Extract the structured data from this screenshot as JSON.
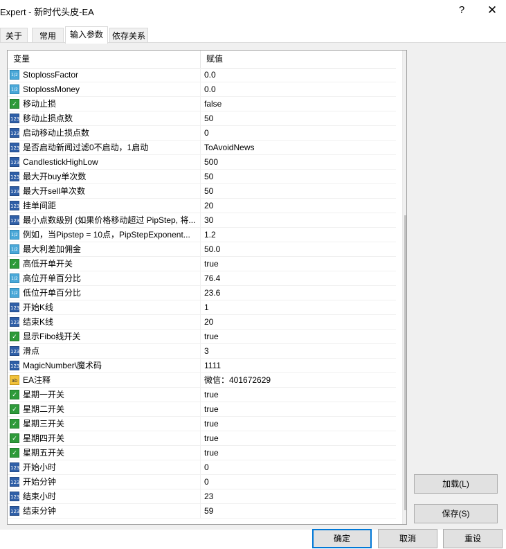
{
  "window": {
    "title": "Expert - 新时代头皮-EA",
    "help_glyph": "?",
    "close_glyph": "✕"
  },
  "tabs": [
    {
      "label": "关于"
    },
    {
      "label": "常用"
    },
    {
      "label": "输入参数"
    },
    {
      "label": "依存关系"
    }
  ],
  "grid": {
    "col_name": "变量",
    "col_value": "赋值",
    "rows": [
      {
        "icon": "double",
        "name": "StoplossFactor",
        "value": "0.0"
      },
      {
        "icon": "double",
        "name": "StoplossMoney",
        "value": "0.0"
      },
      {
        "icon": "bool",
        "name": "移动止损",
        "value": "false"
      },
      {
        "icon": "int",
        "name": "移动止损点数",
        "value": "50"
      },
      {
        "icon": "int",
        "name": "启动移动止损点数",
        "value": "0"
      },
      {
        "icon": "int",
        "name": "是否启动新闻过滤0不启动，1启动",
        "value": "ToAvoidNews"
      },
      {
        "icon": "int",
        "name": "CandlestickHighLow",
        "value": "500"
      },
      {
        "icon": "int",
        "name": "最大开buy单次数",
        "value": "50"
      },
      {
        "icon": "int",
        "name": "最大开sell单次数",
        "value": "50"
      },
      {
        "icon": "int",
        "name": "挂单间距",
        "value": "20"
      },
      {
        "icon": "int",
        "name": "最小点数级别 (如果价格移动超过 PipStep, 将...",
        "value": "30"
      },
      {
        "icon": "double",
        "name": "例如，当Pipstep = 10点，PipStepExponent...",
        "value": "1.2"
      },
      {
        "icon": "double",
        "name": "最大利差加佣金",
        "value": "50.0"
      },
      {
        "icon": "bool",
        "name": "高低开单开关",
        "value": "true"
      },
      {
        "icon": "double",
        "name": "高位开单百分比",
        "value": "76.4"
      },
      {
        "icon": "double",
        "name": "低位开单百分比",
        "value": "23.6"
      },
      {
        "icon": "int",
        "name": "开始K线",
        "value": "1"
      },
      {
        "icon": "int",
        "name": "结束K线",
        "value": "20"
      },
      {
        "icon": "bool",
        "name": "显示Fibo线开关",
        "value": "true"
      },
      {
        "icon": "int",
        "name": "滑点",
        "value": "3"
      },
      {
        "icon": "int",
        "name": "MagicNumber\\魔术码",
        "value": "1111"
      },
      {
        "icon": "string",
        "name": "EA注释",
        "value": "微信：401672629"
      },
      {
        "icon": "bool",
        "name": "星期一开关",
        "value": "true"
      },
      {
        "icon": "bool",
        "name": "星期二开关",
        "value": "true"
      },
      {
        "icon": "bool",
        "name": "星期三开关",
        "value": "true"
      },
      {
        "icon": "bool",
        "name": "星期四开关",
        "value": "true"
      },
      {
        "icon": "bool",
        "name": "星期五开关",
        "value": "true"
      },
      {
        "icon": "int",
        "name": "开始小时",
        "value": "0"
      },
      {
        "icon": "int",
        "name": "开始分钟",
        "value": "0"
      },
      {
        "icon": "int",
        "name": "结束小时",
        "value": "23"
      },
      {
        "icon": "int",
        "name": "结束分钟",
        "value": "59"
      }
    ]
  },
  "side_buttons": {
    "load": "加载(L)",
    "save": "保存(S)"
  },
  "footer_buttons": {
    "ok": "确定",
    "cancel": "取消",
    "reset": "重设"
  },
  "icon_glyphs": {
    "int": "123",
    "double": "1/2",
    "bool": "✓",
    "string": "ab"
  },
  "scrollbar": {
    "up_glyph": "▲",
    "down_glyph": "▼",
    "visible_fraction": 0.64
  }
}
